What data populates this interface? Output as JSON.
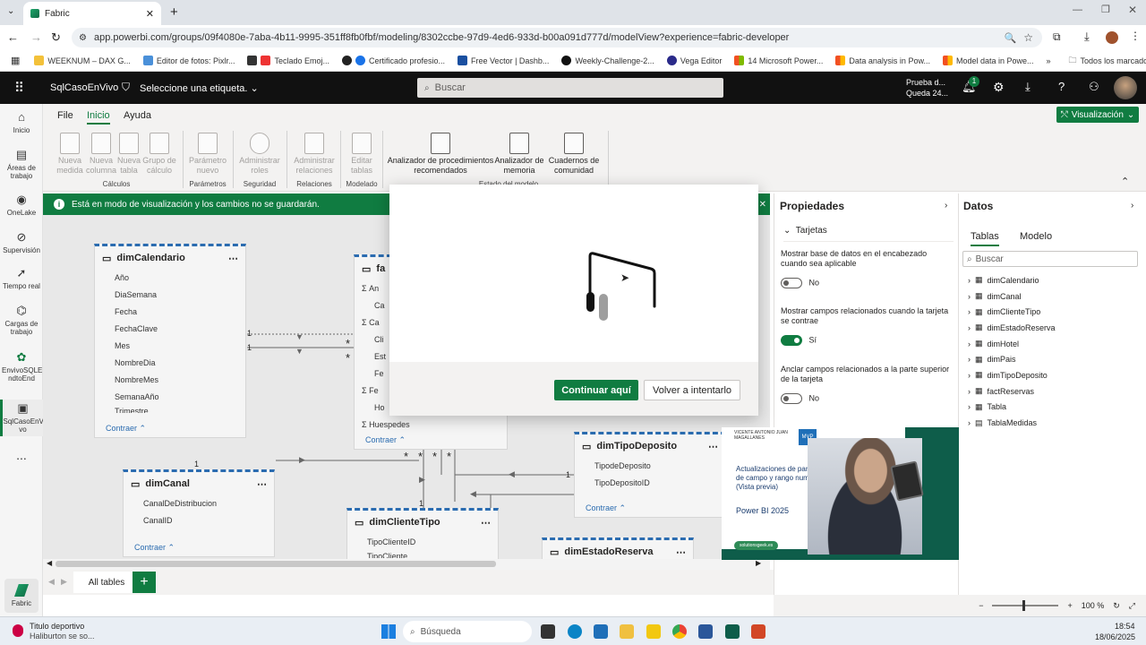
{
  "browser": {
    "tab_title": "Fabric",
    "url": "app.powerbi.com/groups/09f4080e-7aba-4b11-9995-351ff8fb0fbf/modeling/8302ccbe-97d9-4ed6-933d-b00a091d777d/modelView?experience=fabric-developer",
    "bookmarks": [
      "WEEKNUM – DAX G...",
      "Editor de fotos: Pixlr...",
      "Teclado Emoj...",
      "Certificado profesio...",
      "Free Vector | Dashb...",
      "Weekly-Challenge-2...",
      "Vega Editor",
      "14 Microsoft Power...",
      "Data analysis in Pow...",
      "Model data in Powe..."
    ],
    "all_bookmarks": "Todos los marcadores"
  },
  "header": {
    "app_name": "SqlCasoEnVivo",
    "label_prompt": "Seleccione una etiqueta.",
    "search_placeholder": "Buscar",
    "trial_line1": "Prueba d...",
    "trial_line2": "Queda 24...",
    "notif_count": "1"
  },
  "rail": [
    {
      "label": "Inicio",
      "icon": "home-icon"
    },
    {
      "label": "Áreas de trabajo",
      "icon": "workspaces-icon"
    },
    {
      "label": "OneLake",
      "icon": "onelake-icon"
    },
    {
      "label": "Supervisión",
      "icon": "monitor-icon"
    },
    {
      "label": "Tiempo real",
      "icon": "realtime-icon"
    },
    {
      "label": "Cargas de trabajo",
      "icon": "workloads-icon"
    },
    {
      "label": "EnvivoSQLE ndtoEnd",
      "icon": "sql-icon"
    },
    {
      "label": "SqlCasoEnVi vo",
      "icon": "model-icon"
    },
    {
      "label": "...",
      "icon": "more-icon"
    }
  ],
  "fabric_label": "Fabric",
  "ribbon": {
    "tabs": [
      "File",
      "Inicio",
      "Ayuda"
    ],
    "visualization": "Visualización",
    "buttons": [
      {
        "label": "Nueva medida"
      },
      {
        "label": "Nueva columna"
      },
      {
        "label": "Nueva tabla"
      },
      {
        "label": "Grupo de cálculo"
      },
      {
        "label": "Parámetro nuevo"
      },
      {
        "label": "Administrar roles"
      },
      {
        "label": "Administrar relaciones"
      },
      {
        "label": "Editar tablas"
      },
      {
        "label": "Analizador de procedimientos recomendados"
      },
      {
        "label": "Analizador de memoria"
      },
      {
        "label": "Cuadernos de comunidad"
      }
    ],
    "groups": [
      "Cálculos",
      "Parámetros",
      "Seguridad",
      "Relaciones",
      "Modelado",
      "Estado del modelo"
    ]
  },
  "infobar": "Está en modo de visualización y los cambios no se guardarán.",
  "cards": {
    "dimCalendario": {
      "title": "dimCalendario",
      "fields": [
        "Año",
        "DiaSemana",
        "Fecha",
        "FechaClave",
        "Mes",
        "NombreDia",
        "NombreMes",
        "SemanaAño",
        "Trimestre"
      ]
    },
    "fact": {
      "title": "fa",
      "fields": [
        "An",
        "Ca",
        "Ca",
        "Cli",
        "Est",
        "Fe",
        "Fe",
        "Ho",
        "Huespedes"
      ]
    },
    "dimCanal": {
      "title": "dimCanal",
      "fields": [
        "CanalDeDistribucion",
        "CanalID"
      ]
    },
    "dimClienteTipo": {
      "title": "dimClienteTipo",
      "fields": [
        "TipoClienteID",
        "TipoCliente"
      ]
    },
    "dimTipoDeposito": {
      "title": "dimTipoDeposito",
      "fields": [
        "TipodeDeposito",
        "TipoDepositoID"
      ]
    },
    "dimEstadoReserva": {
      "title": "dimEstadoReserva",
      "fields": []
    },
    "collapse": "Contraer"
  },
  "rel_labels": {
    "one": "1",
    "many": "*"
  },
  "dialog": {
    "continue": "Continuar aquí",
    "retry": "Volver a intentarlo"
  },
  "properties": {
    "title": "Propiedades",
    "section": "Tarjetas",
    "items": [
      {
        "label": "Mostrar base de datos en el encabezado cuando sea aplicable",
        "state": "No",
        "on": false
      },
      {
        "label": "Mostrar campos relacionados cuando la tarjeta se contrae",
        "state": "Sí",
        "on": true
      },
      {
        "label": "Anclar campos relacionados a la parte superior de la tarjeta",
        "state": "No",
        "on": false
      }
    ]
  },
  "data_pane": {
    "title": "Datos",
    "tabs": [
      "Tablas",
      "Modelo"
    ],
    "search_placeholder": "Buscar",
    "tables": [
      "dimCalendario",
      "dimCanal",
      "dimClienteTipo",
      "dimEstadoReserva",
      "dimHotel",
      "dimPais",
      "dimTipoDeposito",
      "factReservas",
      "Tabla",
      "TablaMedidas"
    ]
  },
  "bottom": {
    "tab": "All tables",
    "zoom": "100 %"
  },
  "video": {
    "presenter": "VICENTE ANTONIO JUAN MAGALLANES",
    "badge": "MVP",
    "line1": "Actualizaciones de parám",
    "line2": "de campo y rango numé",
    "line3": "(Vista previa)",
    "line4": "Power BI 2025",
    "site": "solutionsgeek.es"
  },
  "taskbar": {
    "notif_title": "Titulo deportivo",
    "notif_sub": "Haliburton se so...",
    "search": "Búsqueda",
    "time": "18:54",
    "date": "18/06/2025"
  }
}
